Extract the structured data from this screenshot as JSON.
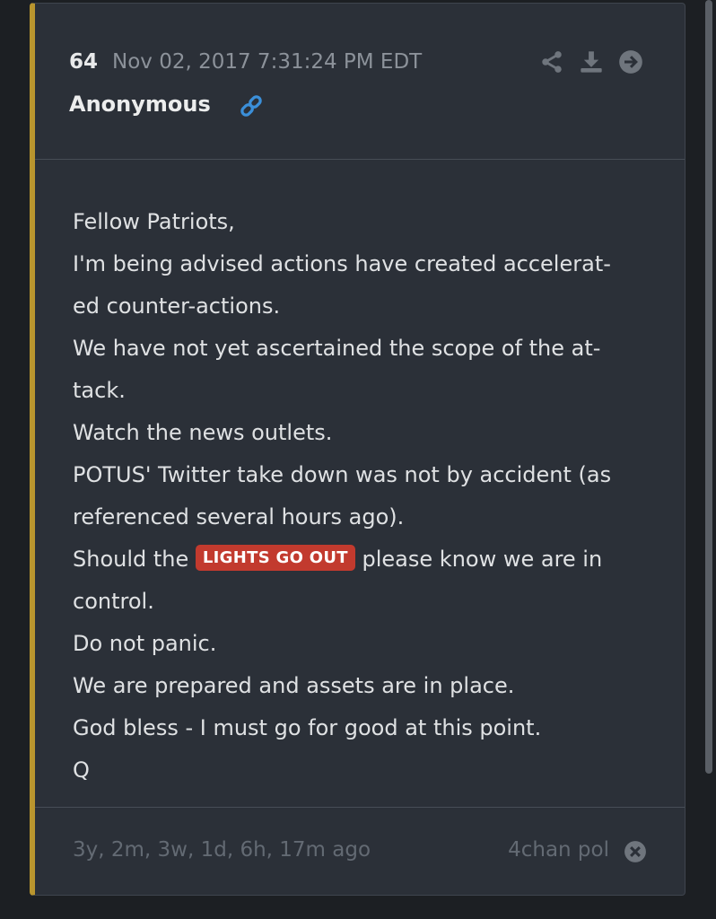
{
  "post": {
    "number": "64",
    "date": "Nov 02, 2017 7:31:24 PM EDT",
    "author": "Anonymous",
    "lines": [
      "Fellow Patriots,",
      "I'm being advised actions have created accelerat-",
      "ed counter-actions.",
      "We have not yet ascertained the scope of the at-",
      "tack.",
      "Watch the news outlets.",
      "POTUS' Twitter take down was not by accident (as",
      "referenced several hours ago)."
    ],
    "highlight_line": {
      "before": "Should the",
      "highlight": "LIGHTS GO OUT",
      "after": "please know we are in"
    },
    "lines_after": [
      "control.",
      "Do not panic.",
      "We are prepared and assets are in place.",
      "God bless - I must go for good at this point.",
      "Q"
    ],
    "ago": "3y, 2m, 3w, 1d, 6h, 17m ago",
    "source": "4chan pol"
  },
  "colors": {
    "accent_border": "#b9952e",
    "highlight_bg": "#c23a2e",
    "link_icon": "#3b8fd9",
    "card_bg": "#2b3038"
  },
  "icons": {
    "header_actions": [
      "share-icon",
      "download-icon",
      "arrow-right-circle-icon"
    ],
    "author_link": "link-icon",
    "footer_close": "close-circle-icon"
  }
}
